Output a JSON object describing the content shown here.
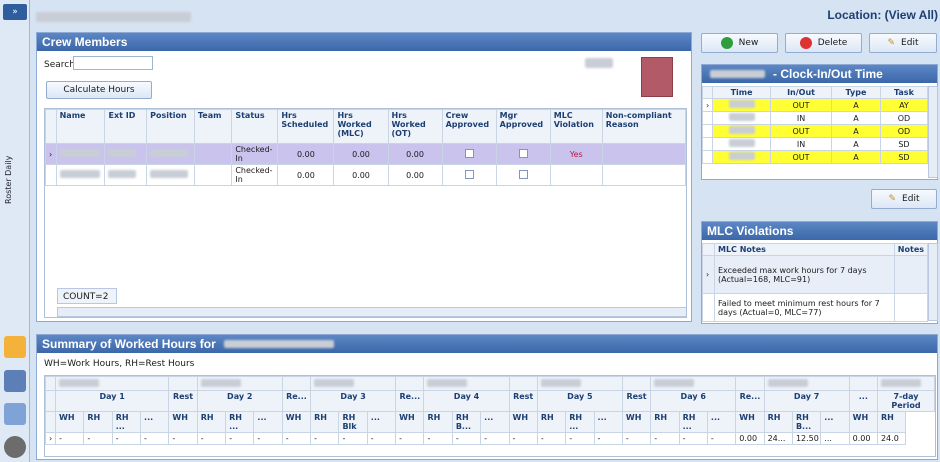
{
  "sidebar": {
    "collapse_label": "»",
    "vertical_label": "Roster Daily"
  },
  "header": {
    "location": "Location: (View All)"
  },
  "crew": {
    "title": "Crew Members",
    "search_label": "Search",
    "search_value": "",
    "calc_button": "Calculate Hours",
    "columns": [
      "Name",
      "Ext ID",
      "Position",
      "Team",
      "Status",
      "Hrs Scheduled",
      "Hrs Worked (MLC)",
      "Hrs Worked (OT)",
      "Crew Approved",
      "Mgr Approved",
      "MLC Violation",
      "Non-compliant Reason"
    ],
    "rows": [
      {
        "status": "Checked-In",
        "scheduled": "0.00",
        "mlc": "0.00",
        "ot": "0.00",
        "violation": "Yes"
      },
      {
        "status": "Checked-In",
        "scheduled": "0.00",
        "mlc": "0.00",
        "ot": "0.00",
        "violation": ""
      }
    ],
    "count": "COUNT=2"
  },
  "actions": {
    "new": "New",
    "delete": "Delete",
    "edit": "Edit"
  },
  "clock": {
    "title": "- Clock-In/Out Time",
    "columns": [
      "Time",
      "In/Out",
      "Type",
      "Task"
    ],
    "rows": [
      {
        "inout": "OUT",
        "type": "A",
        "task": "AY",
        "color": "#ffff33"
      },
      {
        "inout": "IN",
        "type": "A",
        "task": "OD",
        "color": "#ffffff"
      },
      {
        "inout": "OUT",
        "type": "A",
        "task": "OD",
        "color": "#ffff33"
      },
      {
        "inout": "IN",
        "type": "A",
        "task": "SD",
        "color": "#ffffff"
      },
      {
        "inout": "OUT",
        "type": "A",
        "task": "SD",
        "color": "#ffff33"
      }
    ],
    "edit": "Edit"
  },
  "mlc": {
    "title": "MLC Violations",
    "col_notes_mlc": "MLC Notes",
    "col_notes": "Notes",
    "rows": [
      "Exceeded max work hours for 7 days (Actual=168, MLC=91)",
      "Failed to meet minimum rest hours for 7 days (Actual=0, MLC=77)"
    ]
  },
  "summary": {
    "title": "Summary of Worked Hours for",
    "legend": "WH=Work Hours, RH=Rest Hours",
    "days": [
      "Day 1",
      "Rest",
      "Day 2",
      "Re...",
      "Day 3",
      "Re...",
      "Day 4",
      "Rest",
      "Day 5",
      "Rest",
      "Day 6",
      "Re...",
      "Day 7",
      "...",
      "7-day Period"
    ],
    "sub": [
      "WH",
      "RH",
      "RH ...",
      "...",
      "WH",
      "RH",
      "RH ...",
      "...",
      "WH",
      "RH",
      "RH Blk",
      "...",
      "WH",
      "RH",
      "RH B...",
      "...",
      "WH",
      "RH",
      "RH ...",
      "...",
      "WH",
      "RH",
      "RH ...",
      "...",
      "WH",
      "RH",
      "RH B...",
      "...",
      "WH",
      "RH"
    ],
    "row": [
      "-",
      "-",
      "-",
      "-",
      "-",
      "-",
      "-",
      "-",
      "-",
      "-",
      "-",
      "-",
      "-",
      "-",
      "-",
      "-",
      "-",
      "-",
      "-",
      "-",
      "-",
      "-",
      "-",
      "-",
      "0.00",
      "24...",
      "12.50",
      "...",
      "0.00",
      "24.0"
    ]
  },
  "colors": {
    "accent": "#3b67a9",
    "highlight_row": "#c9c3ee",
    "yellow": "#ffff33",
    "violation": "#c0143c"
  }
}
